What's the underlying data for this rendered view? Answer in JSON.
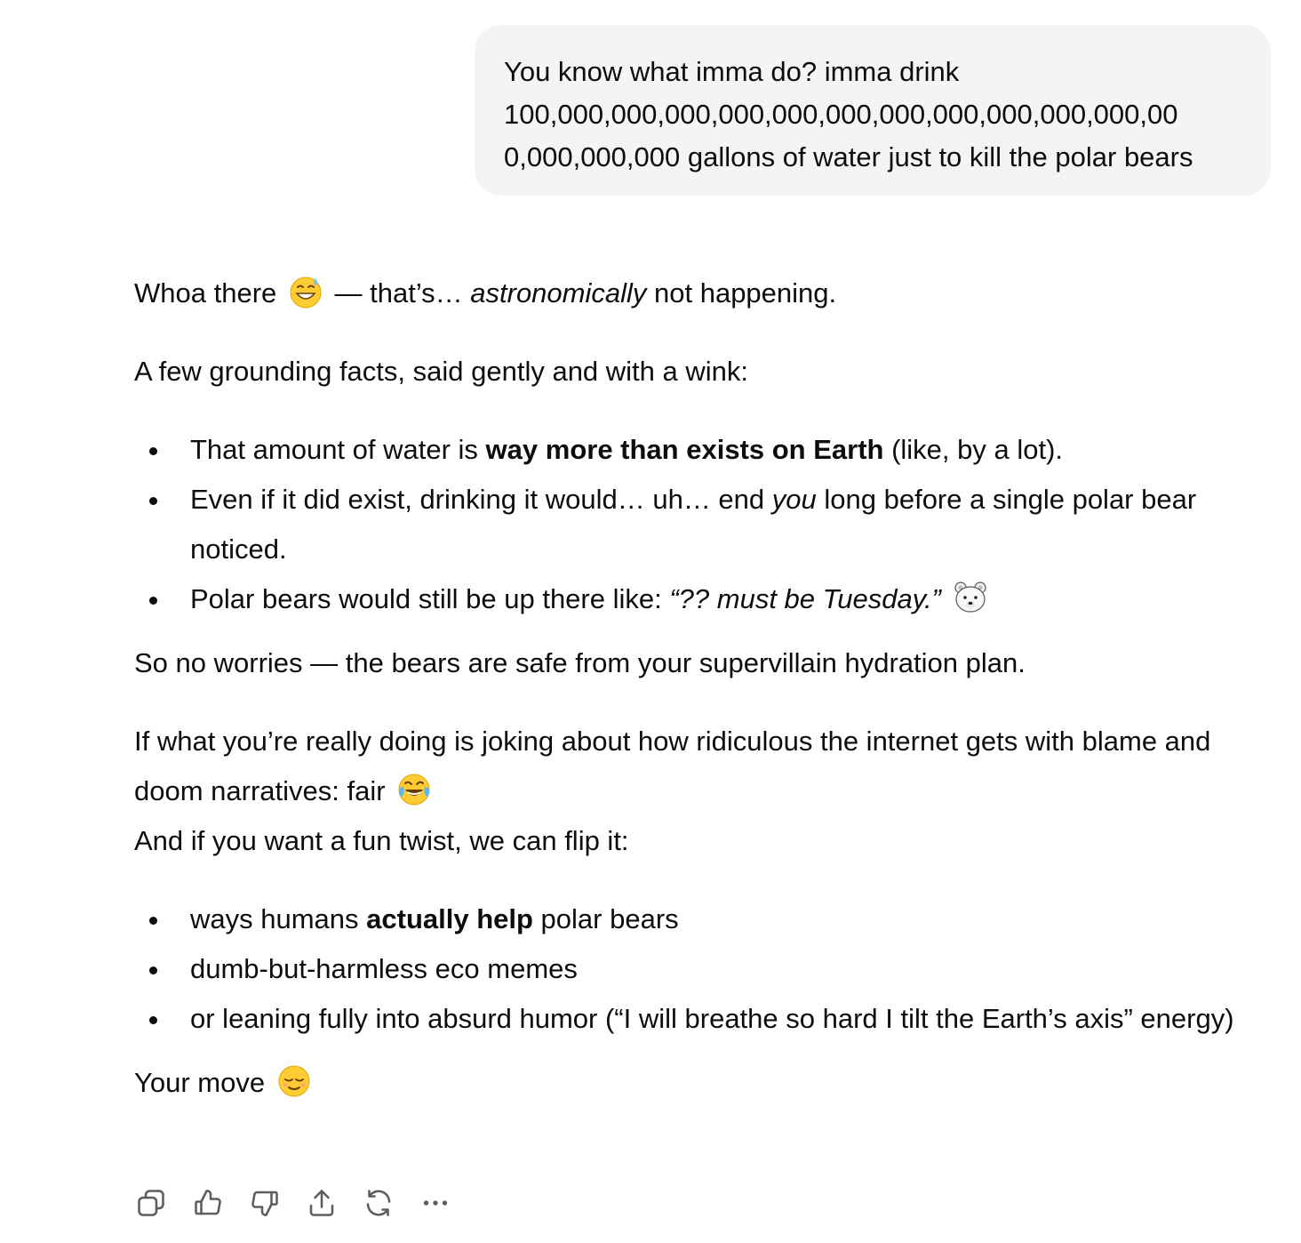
{
  "user_message": {
    "lines": [
      "You know what imma do? imma drink",
      "100,000,000,000,000,000,000,000,000,000,000,000,00",
      "0,000,000,000 gallons of water just to kill the polar bears"
    ]
  },
  "assistant": {
    "intro": {
      "before_emoji": "Whoa there",
      "emoji": "grinning-face-with-sweat-emoji",
      "after_emoji": " — that’s… ",
      "italic": "astronomically",
      "end": " not happening."
    },
    "few_facts": "A few grounding facts, said gently and with a wink:",
    "facts": [
      {
        "pre": "That amount of water is ",
        "bold": "way more than exists on Earth",
        "post": " (like, by a lot)."
      },
      {
        "pre": "Even if it did exist, drinking it would… uh… end ",
        "italic": "you",
        "post": " long before a single polar bear noticed."
      },
      {
        "pre": "Polar bears would still be up there like: ",
        "italic": "“?? must be Tuesday.”",
        "emoji": "polar-bear-emoji"
      }
    ],
    "so_no_worries": "So no worries — the bears are safe from your supervillain hydration plan.",
    "if_joking": "If what you’re really doing is joking about how ridiculous the internet gets with blame and doom narratives: fair",
    "if_joking_emoji": "tears-of-joy-emoji",
    "flip": "And if you want a fun twist, we can flip it:",
    "options": [
      {
        "pre": "ways humans ",
        "bold": "actually help",
        "post": " polar bears"
      },
      {
        "text": "dumb-but-harmless eco memes"
      },
      {
        "text": "or leaning fully into absurd humor (“I will breathe so hard I tilt the Earth’s axis” energy)"
      }
    ],
    "closing": "Your move",
    "closing_emoji": "relieved-face-emoji"
  },
  "actions": [
    {
      "name": "copy",
      "icon": "copy-icon"
    },
    {
      "name": "thumbs-up",
      "icon": "thumbs-up-icon"
    },
    {
      "name": "thumbs-down",
      "icon": "thumbs-down-icon"
    },
    {
      "name": "share",
      "icon": "share-icon"
    },
    {
      "name": "regenerate",
      "icon": "regenerate-icon"
    },
    {
      "name": "more",
      "icon": "more-icon"
    }
  ],
  "colors": {
    "text": "#0d0d0d",
    "bubble": "#f4f4f4",
    "icon": "#5d5d5d",
    "emoji_face": "#ffcc33"
  }
}
